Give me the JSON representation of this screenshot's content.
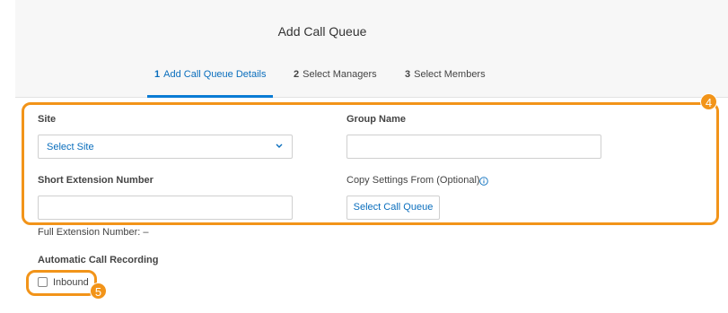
{
  "dialog": {
    "title": "Add Call Queue"
  },
  "steps": [
    {
      "num": "1",
      "label": "Add Call Queue Details",
      "active": true
    },
    {
      "num": "2",
      "label": "Select Managers",
      "active": false
    },
    {
      "num": "3",
      "label": "Select Members",
      "active": false
    }
  ],
  "form": {
    "site_label": "Site",
    "site_value": "Select Site",
    "group_name_label": "Group Name",
    "group_name_value": "",
    "short_ext_label": "Short Extension Number",
    "short_ext_value": "",
    "copy_settings_label": "Copy Settings From (Optional)",
    "select_call_queue_button": "Select Call Queue",
    "full_ext_text": "Full Extension Number: –",
    "auto_recording_label": "Automatic Call Recording",
    "inbound_label": "Inbound",
    "inbound_checked": false
  },
  "annotations": {
    "badge_4": "4",
    "badge_5": "5"
  },
  "colors": {
    "accent": "#0a6ebd",
    "highlight": "#f29419",
    "header_bg": "#f7f7f7"
  },
  "icons": {
    "chevron": "chevron-down-icon",
    "info": "info-icon"
  }
}
